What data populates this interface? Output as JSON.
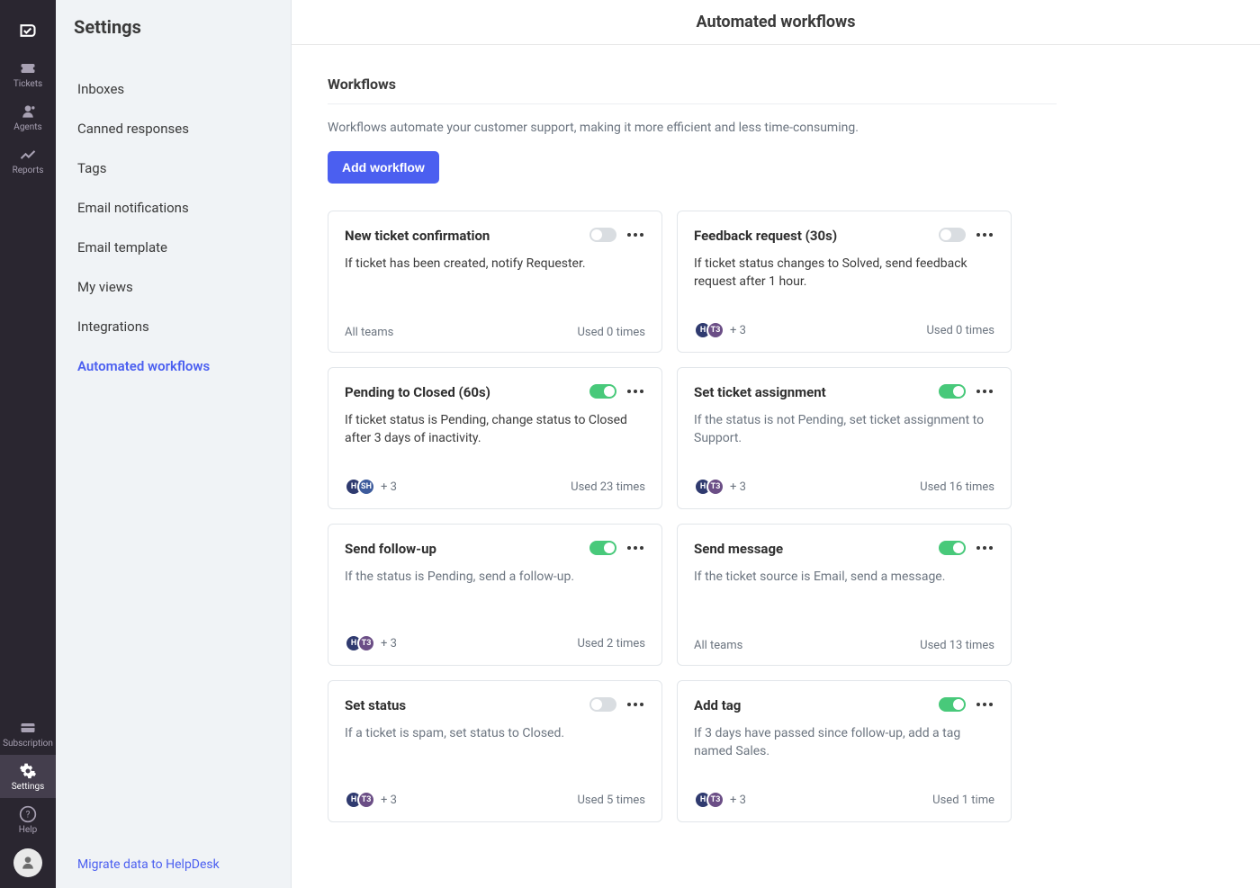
{
  "rail": {
    "items": [
      {
        "key": "tickets",
        "label": "Tickets"
      },
      {
        "key": "agents",
        "label": "Agents"
      },
      {
        "key": "reports",
        "label": "Reports"
      }
    ],
    "bottom": [
      {
        "key": "subscription",
        "label": "Subscription"
      },
      {
        "key": "settings",
        "label": "Settings"
      },
      {
        "key": "help",
        "label": "Help"
      }
    ]
  },
  "sidebar": {
    "title": "Settings",
    "links": [
      "Inboxes",
      "Canned responses",
      "Tags",
      "Email notifications",
      "Email template",
      "My views",
      "Integrations",
      "Automated workflows"
    ],
    "active_index": 7,
    "footer_link": "Migrate data to HelpDesk"
  },
  "main": {
    "header": "Automated workflows",
    "section_title": "Workflows",
    "section_desc": "Workflows automate your customer support, making it more efficient and less time-consuming.",
    "add_button": "Add workflow"
  },
  "workflows": [
    {
      "title": "New ticket confirmation",
      "desc": "If ticket has been created, notify Requester.",
      "enabled": false,
      "teams_label": "All teams",
      "teams_chips": null,
      "usage": "Used 0 times"
    },
    {
      "title": "Feedback request (30s)",
      "desc": "If ticket status changes to Solved, send feedback request after 1 hour.",
      "enabled": false,
      "teams_chips": [
        {
          "t": "H",
          "c": 0
        },
        {
          "t": "T3",
          "c": 1
        }
      ],
      "teams_more": "+ 3",
      "usage": "Used 0 times"
    },
    {
      "title": "Pending to Closed (60s)",
      "desc": "If ticket status is Pending, change status to Closed after 3 days of inactivity.",
      "enabled": true,
      "teams_chips": [
        {
          "t": "H",
          "c": 0
        },
        {
          "t": "SH",
          "c": 2
        }
      ],
      "teams_more": "+ 3",
      "usage": "Used 23 times"
    },
    {
      "title": "Set ticket assignment",
      "desc": "If the status is not Pending, set ticket assignment to Support.",
      "enabled": true,
      "teams_chips": [
        {
          "t": "H",
          "c": 0
        },
        {
          "t": "T3",
          "c": 1
        }
      ],
      "teams_more": "+ 3",
      "usage": "Used 16 times"
    },
    {
      "title": "Send follow-up",
      "desc": "If the status is Pending, send a follow-up.",
      "enabled": true,
      "teams_chips": [
        {
          "t": "H",
          "c": 0
        },
        {
          "t": "T3",
          "c": 1
        }
      ],
      "teams_more": "+ 3",
      "usage": "Used 2 times"
    },
    {
      "title": "Send message",
      "desc": "If the ticket source is Email, send a message.",
      "enabled": true,
      "teams_label": "All teams",
      "teams_chips": null,
      "usage": "Used 13 times"
    },
    {
      "title": "Set status",
      "desc": "If a ticket is spam, set status to Closed.",
      "enabled": false,
      "teams_chips": [
        {
          "t": "H",
          "c": 0
        },
        {
          "t": "T3",
          "c": 1
        }
      ],
      "teams_more": "+ 3",
      "usage": "Used 5 times"
    },
    {
      "title": "Add tag",
      "desc": "If 3 days have passed since follow-up, add a tag named Sales.",
      "enabled": true,
      "teams_chips": [
        {
          "t": "H",
          "c": 0
        },
        {
          "t": "T3",
          "c": 1
        }
      ],
      "teams_more": "+ 3",
      "usage": "Used 1 time"
    }
  ]
}
